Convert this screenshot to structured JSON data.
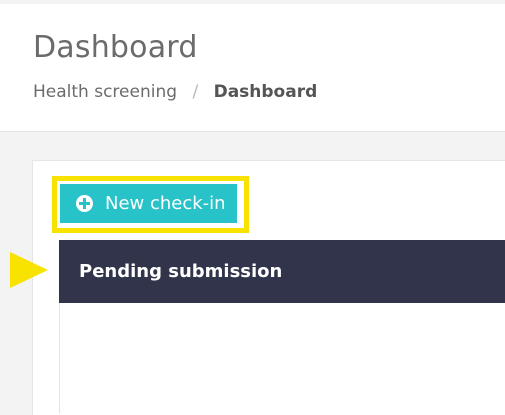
{
  "page": {
    "title": "Dashboard"
  },
  "breadcrumb": {
    "items": [
      "Health screening",
      "Dashboard"
    ],
    "separator": "/"
  },
  "actions": {
    "new_checkin_label": "New check-in",
    "new_checkin_icon": "plus-circle-icon"
  },
  "panel": {
    "title": "Pending submission"
  },
  "colors": {
    "accent": "#28c3c8",
    "highlight": "#f7e200",
    "panel_header": "#31344a",
    "text": "#6b6b6b"
  }
}
